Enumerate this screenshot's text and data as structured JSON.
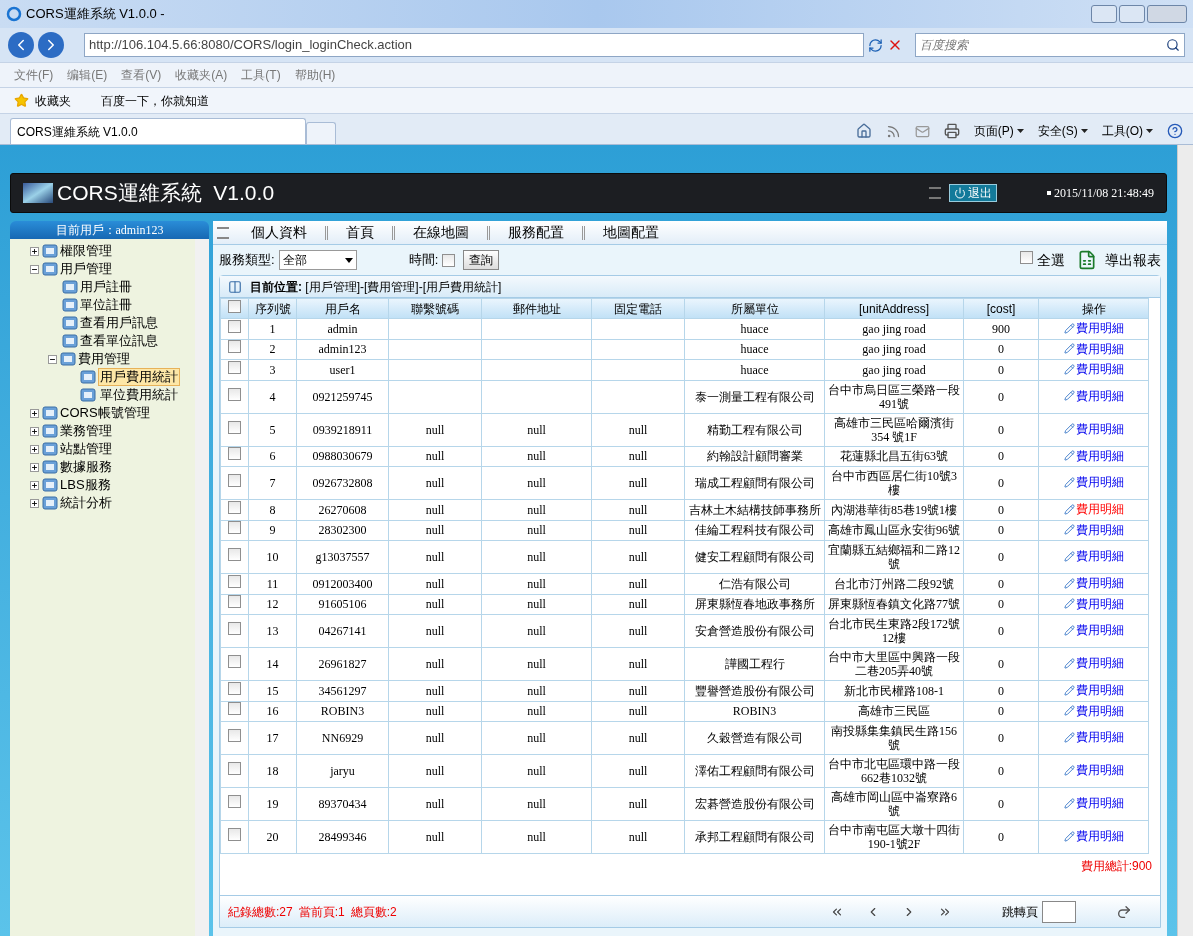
{
  "browser": {
    "title": "CORS運維系統 V1.0.0 -",
    "address": "http://106.104.5.66:8080/CORS/login_loginCheck.action",
    "search_placeholder": "百度搜索",
    "menu": [
      "文件(F)",
      "编辑(E)",
      "查看(V)",
      "收藏夹(A)",
      "工具(T)",
      "帮助(H)"
    ],
    "favorites_label": "收藏夹",
    "favorite_link": "百度一下，你就知道",
    "tab_title": "CORS運維系統 V1.0.0",
    "toolbar": [
      "页面(P)",
      "安全(S)",
      "工具(O)"
    ]
  },
  "app": {
    "title": "CORS運維系統  V1.0.0",
    "logout": "退出",
    "datetime": "2015/11/08 21:48:49",
    "current_user": "目前用戶：admin123",
    "nav": [
      "個人資料",
      "首頁",
      "在線地圖",
      "服務配置",
      "地圖配置"
    ]
  },
  "sidebar": {
    "items": [
      {
        "label": "權限管理",
        "expanded": false
      },
      {
        "label": "用戶管理",
        "expanded": true,
        "children": [
          {
            "label": "用戶註冊",
            "selected": false
          },
          {
            "label": "單位註冊",
            "selected": false
          },
          {
            "label": "查看用戶訊息",
            "selected": false
          },
          {
            "label": "查看單位訊息",
            "selected": false
          },
          {
            "label": "費用管理",
            "expanded": true,
            "selected": false,
            "children": [
              {
                "label": "用戶費用統計",
                "selected": true
              },
              {
                "label": "單位費用統計",
                "selected": false
              }
            ]
          }
        ]
      },
      {
        "label": "CORS帳號管理",
        "expanded": false
      },
      {
        "label": "業務管理",
        "expanded": false
      },
      {
        "label": "站點管理",
        "expanded": false
      },
      {
        "label": "數據服務",
        "expanded": false
      },
      {
        "label": "LBS服務",
        "expanded": false
      },
      {
        "label": "統計分析",
        "expanded": false
      }
    ]
  },
  "filter": {
    "service_type_label": "服務類型:",
    "service_type": "全部",
    "time_label": "時間:",
    "time_checked": false,
    "query": "查詢",
    "select_all": "全選",
    "select_all_checked": false,
    "export": "導出報表"
  },
  "breadcrumb": {
    "label": "目前位置:",
    "path": "[用戶管理]-[費用管理]-[用戶費用統計]"
  },
  "table": {
    "header_checked": false,
    "columns": [
      "序列號",
      "用戶名",
      "聯繫號碼",
      "郵件地址",
      "固定電話",
      "所屬單位",
      "[unitAddress]",
      "[cost]",
      "操作"
    ],
    "rows": [
      {
        "cells": [
          "1",
          "admin",
          "",
          "",
          "",
          "huace",
          "gao jing road",
          "900"
        ],
        "action": "費用明細",
        "checked": false,
        "link_active": false
      },
      {
        "cells": [
          "2",
          "admin123",
          "",
          "",
          "",
          "huace",
          "gao jing road",
          "0"
        ],
        "action": "費用明細",
        "checked": false,
        "link_active": false
      },
      {
        "cells": [
          "3",
          "user1",
          "",
          "",
          "",
          "huace",
          "gao jing road",
          "0"
        ],
        "action": "費用明細",
        "checked": false,
        "link_active": false
      },
      {
        "cells": [
          "4",
          "0921259745",
          "",
          "",
          "",
          "泰一測量工程有限公司",
          "台中市烏日區三榮路一段491號",
          "0"
        ],
        "action": "費用明細",
        "checked": false,
        "link_active": false
      },
      {
        "cells": [
          "5",
          "0939218911",
          "null",
          "null",
          "null",
          "精勤工程有限公司",
          "高雄市三民區哈爾濱街354 號1F",
          "0"
        ],
        "action": "費用明細",
        "checked": false,
        "link_active": false
      },
      {
        "cells": [
          "6",
          "0988030679",
          "null",
          "null",
          "null",
          "約翰設計顧問審業",
          "花蓮縣北昌五街63號",
          "0"
        ],
        "action": "費用明細",
        "checked": false,
        "link_active": false
      },
      {
        "cells": [
          "7",
          "0926732808",
          "null",
          "null",
          "null",
          "瑞成工程顧問有限公司",
          "台中市西區居仁街10號3樓",
          "0"
        ],
        "action": "費用明細",
        "checked": false,
        "link_active": false
      },
      {
        "cells": [
          "8",
          "26270608",
          "null",
          "null",
          "null",
          "吉林土木結構技師事務所",
          "內湖港華街85巷19號1樓",
          "0"
        ],
        "action": "費用明細",
        "checked": false,
        "link_active": true
      },
      {
        "cells": [
          "9",
          "28302300",
          "null",
          "null",
          "null",
          "佳綸工程科技有限公司",
          "高雄市鳳山區永安街96號",
          "0"
        ],
        "action": "費用明細",
        "checked": false,
        "link_active": false
      },
      {
        "cells": [
          "10",
          "g13037557",
          "null",
          "null",
          "null",
          "健安工程顧問有限公司",
          "宜蘭縣五結鄉福和二路12號",
          "0"
        ],
        "action": "費用明細",
        "checked": false,
        "link_active": false
      },
      {
        "cells": [
          "11",
          "0912003400",
          "null",
          "null",
          "null",
          "仁浩有限公司",
          "台北市汀州路二段92號",
          "0"
        ],
        "action": "費用明細",
        "checked": false,
        "link_active": false
      },
      {
        "cells": [
          "12",
          "91605106",
          "null",
          "null",
          "null",
          "屏東縣恆春地政事務所",
          "屏東縣恆春鎮文化路77號",
          "0"
        ],
        "action": "費用明細",
        "checked": false,
        "link_active": false
      },
      {
        "cells": [
          "13",
          "04267141",
          "null",
          "null",
          "null",
          "安倉營造股份有限公司",
          "台北市民生東路2段172號12樓",
          "0"
        ],
        "action": "費用明細",
        "checked": false,
        "link_active": false
      },
      {
        "cells": [
          "14",
          "26961827",
          "null",
          "null",
          "null",
          "譁國工程行",
          "台中市大里區中興路一段二巷205弄40號",
          "0"
        ],
        "action": "費用明細",
        "checked": false,
        "link_active": false
      },
      {
        "cells": [
          "15",
          "34561297",
          "null",
          "null",
          "null",
          "豐譽營造股份有限公司",
          "新北市民權路108-1",
          "0"
        ],
        "action": "費用明細",
        "checked": false,
        "link_active": false
      },
      {
        "cells": [
          "16",
          "ROBIN3",
          "null",
          "null",
          "null",
          "ROBIN3",
          "高雄市三民區",
          "0"
        ],
        "action": "費用明細",
        "checked": false,
        "link_active": false
      },
      {
        "cells": [
          "17",
          "NN6929",
          "null",
          "null",
          "null",
          "久穀營造有限公司",
          "南投縣集集鎮民生路156號",
          "0"
        ],
        "action": "費用明細",
        "checked": false,
        "link_active": false
      },
      {
        "cells": [
          "18",
          "jaryu",
          "null",
          "null",
          "null",
          "澤佑工程顧問有限公司",
          "台中市北屯區環中路一段662巷1032號",
          "0"
        ],
        "action": "費用明細",
        "checked": false,
        "link_active": false
      },
      {
        "cells": [
          "19",
          "89370434",
          "null",
          "null",
          "null",
          "宏碁營造股份有限公司",
          "高雄市岡山區中崙寮路6號",
          "0"
        ],
        "action": "費用明細",
        "checked": false,
        "link_active": false
      },
      {
        "cells": [
          "20",
          "28499346",
          "null",
          "null",
          "null",
          "承邦工程顧問有限公司",
          "台中市南屯區大墩十四街190-1號2F",
          "0"
        ],
        "action": "費用明細",
        "checked": false,
        "link_active": false
      }
    ],
    "total": "費用總計:900"
  },
  "pager": {
    "records": "紀錄總數:27",
    "current": "當前頁:1",
    "pages": "總頁數:2",
    "jump_label": "跳轉頁"
  }
}
